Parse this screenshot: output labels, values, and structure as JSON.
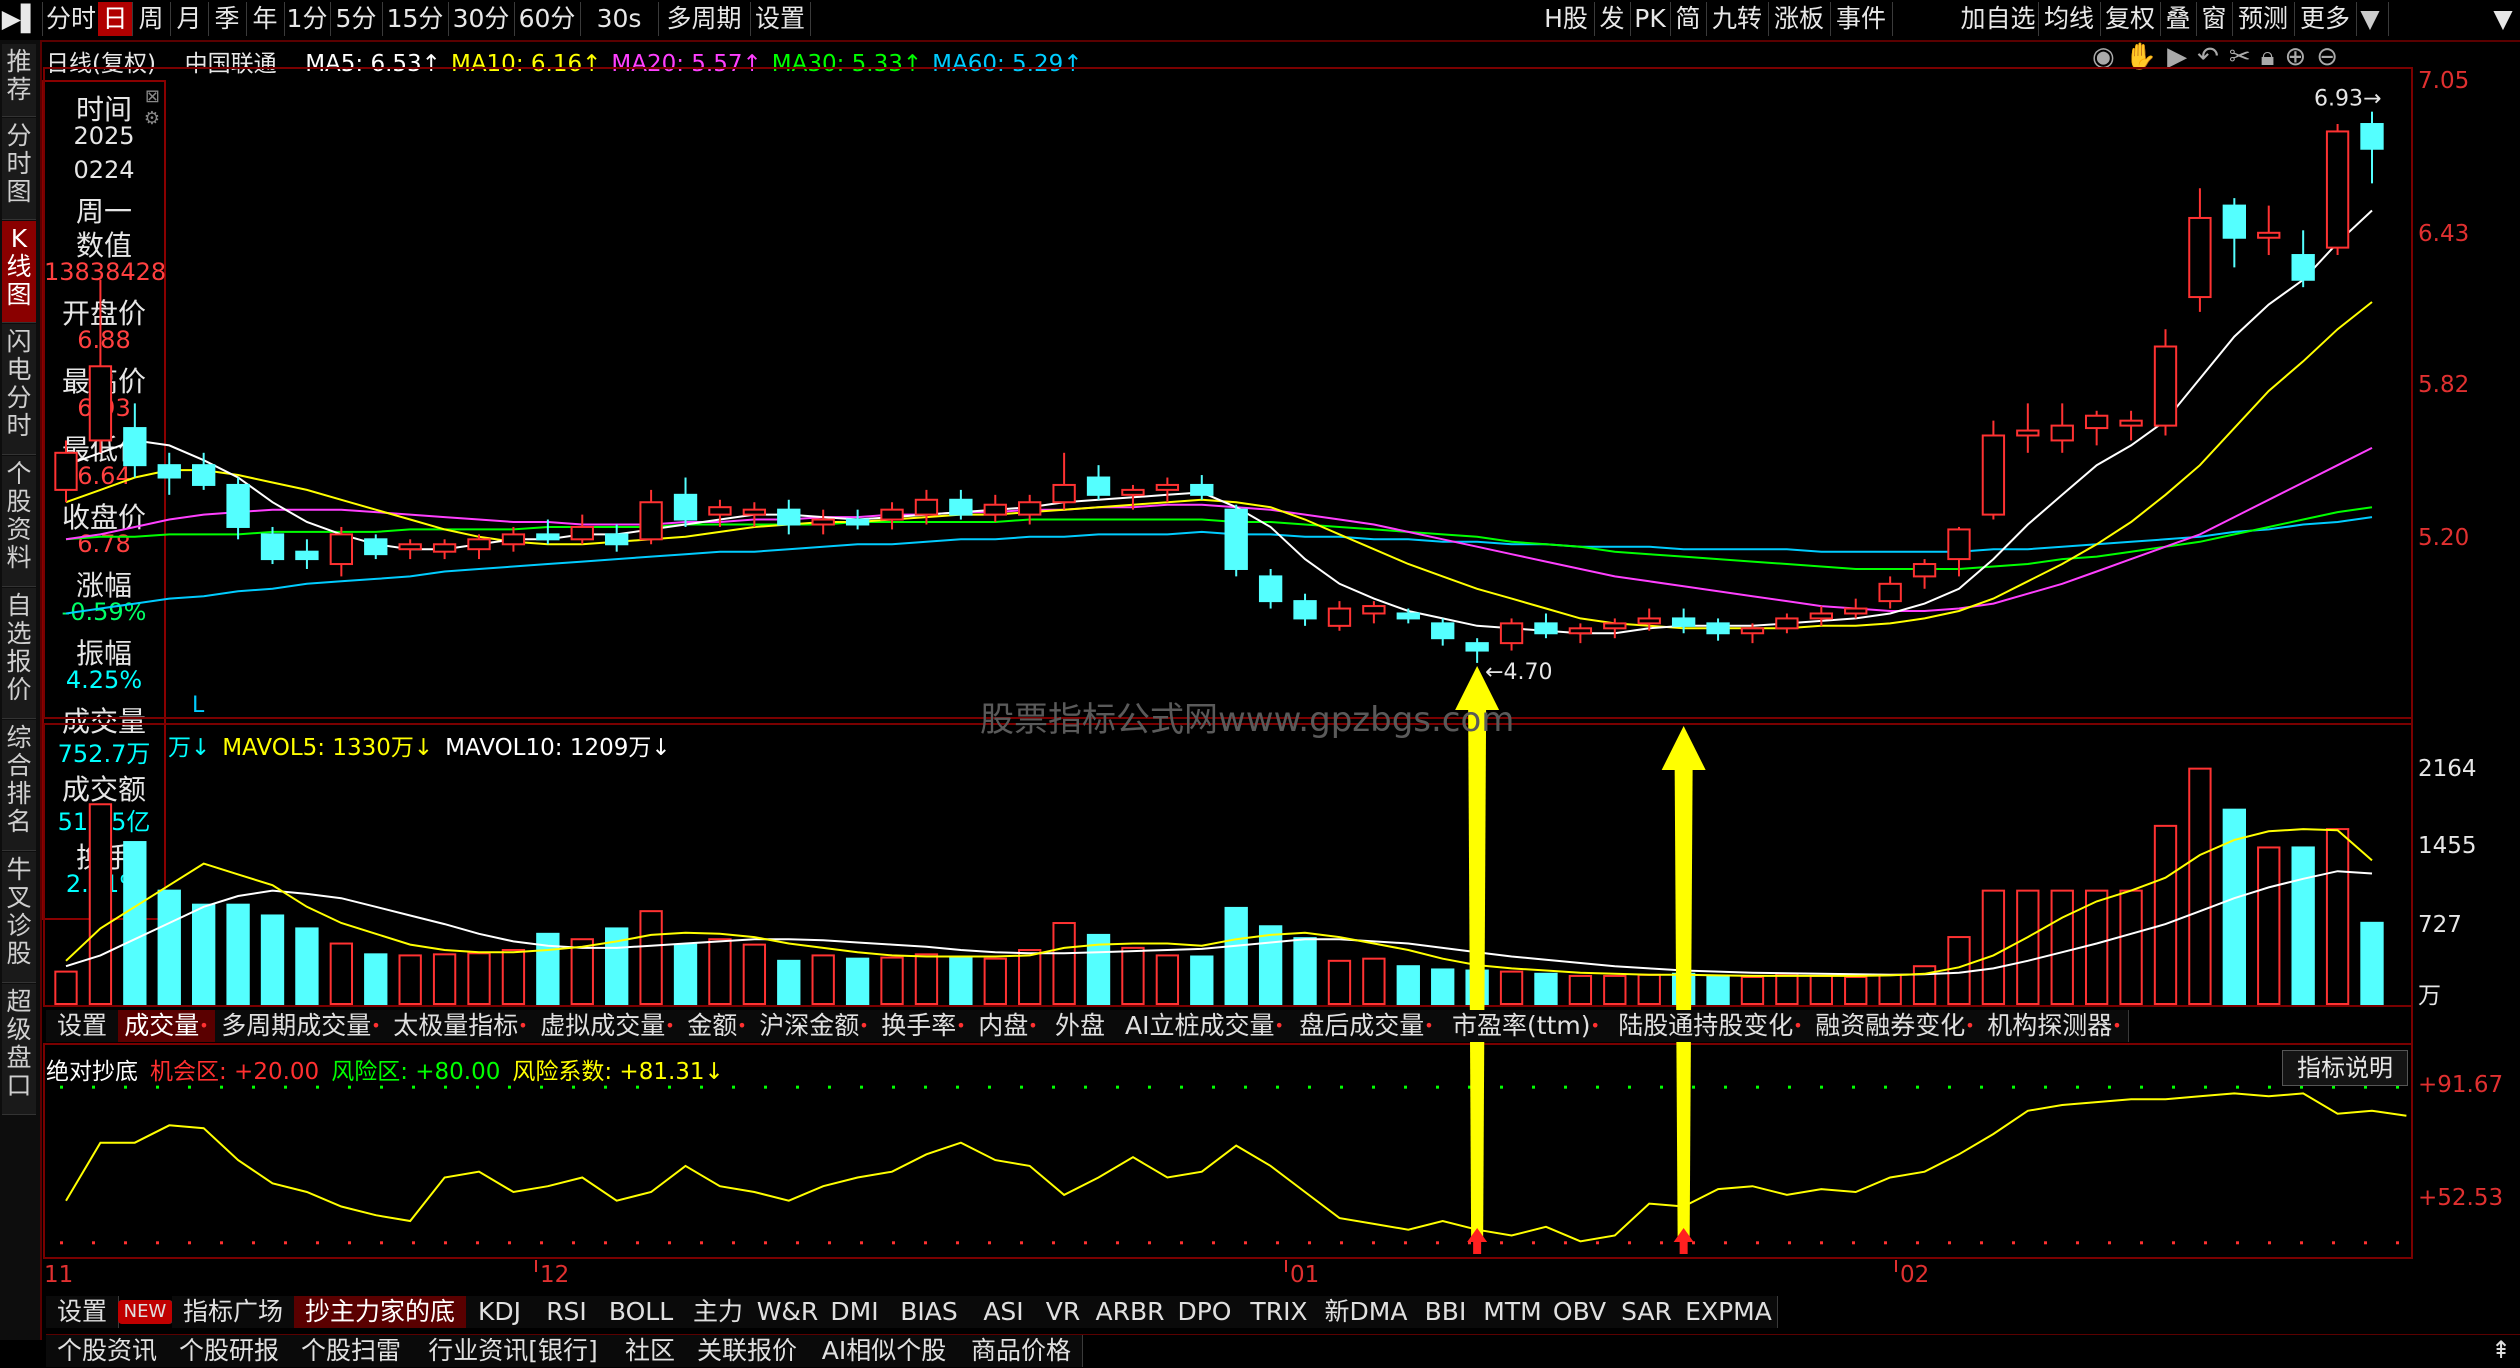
{
  "toolbar": {
    "left": [
      "分时",
      "日",
      "周",
      "月",
      "季",
      "年",
      "1分",
      "5分",
      "15分",
      "30分",
      "60分",
      "30s",
      "多周期",
      "设置"
    ],
    "right": [
      "H股",
      "发",
      "PK",
      "简",
      "九转",
      "涨板",
      "事件",
      "加自选",
      "均线",
      "复权",
      "叠",
      "窗",
      "预测",
      "更多"
    ]
  },
  "sidebar": [
    "推荐",
    "分时图",
    "K线图",
    "闪电分时",
    "个股资料",
    "自选报价",
    "综合排名",
    "牛叉诊股",
    "超级盘口"
  ],
  "header": {
    "period": "日线(复权)",
    "stock": "中国联通",
    "ma": [
      {
        "label": "MA5: 6.53↑",
        "color": "#ffffff"
      },
      {
        "label": "MA10: 6.16↑",
        "color": "#ffff00"
      },
      {
        "label": "MA20: 5.57↑",
        "color": "#ff40ff"
      },
      {
        "label": "MA30: 5.33↑",
        "color": "#00ff00"
      },
      {
        "label": "MA60: 5.29↑",
        "color": "#00ccff"
      }
    ]
  },
  "infopanel": {
    "items": [
      {
        "label": "时间",
        "value": "2025"
      },
      {
        "label": "",
        "value": "0224"
      },
      {
        "label": "周一",
        "value": ""
      },
      {
        "label": "数值",
        "value": "13838428"
      },
      {
        "label": "开盘价",
        "value": "6.88"
      },
      {
        "label": "最高价",
        "value": "6.93"
      },
      {
        "label": "最低价",
        "value": "6.64"
      },
      {
        "label": "收盘价",
        "value": "6.78"
      },
      {
        "label": "涨幅",
        "value": "-0.59%"
      },
      {
        "label": "振幅",
        "value": "4.25%"
      },
      {
        "label": "成交量",
        "value": "752.7万"
      },
      {
        "label": "成交额",
        "value": "51.35亿"
      },
      {
        "label": "换手",
        "value": "2.41%"
      }
    ]
  },
  "price_axis": [
    "7.05",
    "6.43",
    "5.82",
    "5.20"
  ],
  "price_annotations": {
    "high": "6.93",
    "low": "4.70",
    "marker": "L"
  },
  "watermark": "股票指标公式网www.gpzbgs.com",
  "volume": {
    "legend": [
      {
        "label": "万↓",
        "color": "#00ffff"
      },
      {
        "label": "MAVOL5: 1330万↓",
        "color": "#ffff00"
      },
      {
        "label": "MAVOL10: 1209万↓",
        "color": "#ffffff"
      }
    ],
    "axis": [
      "2164",
      "1455",
      "727",
      "万"
    ]
  },
  "volume_tabs": [
    "设置",
    "成交量",
    "多周期成交量",
    "太极量指标",
    "虚拟成交量",
    "金额",
    "沪深金额",
    "换手率",
    "内盘",
    "外盘",
    "AI立桩成交量",
    "盘后成交量",
    "市盈率(ttm)",
    "陆股通持股变化",
    "融资融券变化",
    "机构探测器"
  ],
  "indicator": {
    "legend": [
      {
        "label": "绝对抄底",
        "color": "#ffffff"
      },
      {
        "label": "机会区: +20.00",
        "color": "#ff3030"
      },
      {
        "label": "风险区: +80.00",
        "color": "#00ff00"
      },
      {
        "label": "风险系数: +81.31↓",
        "color": "#ffff00"
      }
    ],
    "explain_button": "指标说明",
    "axis": [
      "+91.67",
      "+52.53"
    ]
  },
  "date_axis": [
    "11",
    "12",
    "01",
    "02"
  ],
  "indicator_tabs": [
    "设置",
    "NEW",
    "指标广场",
    "抄主力家的底",
    "KDJ",
    "RSI",
    "BOLL",
    "主力",
    "W&R",
    "DMI",
    "BIAS",
    "ASI",
    "VR",
    "ARBR",
    "DPO",
    "TRIX",
    "新DMA",
    "BBI",
    "MTM",
    "OBV",
    "SAR",
    "EXPMA"
  ],
  "bottom_tabs": [
    "个股资讯",
    "个股研报",
    "个股扫雷",
    "行业资讯[银行]",
    "社区",
    "关联报价",
    "AI相似个股",
    "商品价格"
  ],
  "chart_data": {
    "type": "candlestick",
    "price_range": [
      4.55,
      7.05
    ],
    "candles": [
      {
        "o": 5.4,
        "h": 5.6,
        "l": 5.35,
        "c": 5.55
      },
      {
        "o": 5.6,
        "h": 6.25,
        "l": 5.55,
        "c": 5.9
      },
      {
        "o": 5.65,
        "h": 5.75,
        "l": 5.45,
        "c": 5.5
      },
      {
        "o": 5.5,
        "h": 5.55,
        "l": 5.38,
        "c": 5.45
      },
      {
        "o": 5.5,
        "h": 5.55,
        "l": 5.4,
        "c": 5.42
      },
      {
        "o": 5.42,
        "h": 5.45,
        "l": 5.2,
        "c": 5.25
      },
      {
        "o": 5.22,
        "h": 5.25,
        "l": 5.1,
        "c": 5.12
      },
      {
        "o": 5.15,
        "h": 5.2,
        "l": 5.08,
        "c": 5.12
      },
      {
        "o": 5.1,
        "h": 5.25,
        "l": 5.05,
        "c": 5.22
      },
      {
        "o": 5.2,
        "h": 5.22,
        "l": 5.12,
        "c": 5.14
      },
      {
        "o": 5.16,
        "h": 5.2,
        "l": 5.12,
        "c": 5.18
      },
      {
        "o": 5.15,
        "h": 5.2,
        "l": 5.12,
        "c": 5.18
      },
      {
        "o": 5.16,
        "h": 5.22,
        "l": 5.12,
        "c": 5.2
      },
      {
        "o": 5.18,
        "h": 5.25,
        "l": 5.15,
        "c": 5.22
      },
      {
        "o": 5.22,
        "h": 5.28,
        "l": 5.18,
        "c": 5.2
      },
      {
        "o": 5.2,
        "h": 5.3,
        "l": 5.18,
        "c": 5.25
      },
      {
        "o": 5.22,
        "h": 5.26,
        "l": 5.15,
        "c": 5.18
      },
      {
        "o": 5.2,
        "h": 5.4,
        "l": 5.18,
        "c": 5.35
      },
      {
        "o": 5.38,
        "h": 5.45,
        "l": 5.25,
        "c": 5.28
      },
      {
        "o": 5.3,
        "h": 5.36,
        "l": 5.25,
        "c": 5.33
      },
      {
        "o": 5.3,
        "h": 5.35,
        "l": 5.25,
        "c": 5.32
      },
      {
        "o": 5.32,
        "h": 5.36,
        "l": 5.22,
        "c": 5.26
      },
      {
        "o": 5.26,
        "h": 5.32,
        "l": 5.22,
        "c": 5.28
      },
      {
        "o": 5.28,
        "h": 5.32,
        "l": 5.24,
        "c": 5.26
      },
      {
        "o": 5.28,
        "h": 5.35,
        "l": 5.24,
        "c": 5.32
      },
      {
        "o": 5.3,
        "h": 5.4,
        "l": 5.26,
        "c": 5.36
      },
      {
        "o": 5.36,
        "h": 5.4,
        "l": 5.28,
        "c": 5.3
      },
      {
        "o": 5.3,
        "h": 5.38,
        "l": 5.27,
        "c": 5.34
      },
      {
        "o": 5.3,
        "h": 5.38,
        "l": 5.26,
        "c": 5.35
      },
      {
        "o": 5.35,
        "h": 5.55,
        "l": 5.32,
        "c": 5.42
      },
      {
        "o": 5.45,
        "h": 5.5,
        "l": 5.36,
        "c": 5.38
      },
      {
        "o": 5.38,
        "h": 5.42,
        "l": 5.32,
        "c": 5.4
      },
      {
        "o": 5.4,
        "h": 5.45,
        "l": 5.35,
        "c": 5.42
      },
      {
        "o": 5.42,
        "h": 5.46,
        "l": 5.36,
        "c": 5.38
      },
      {
        "o": 5.32,
        "h": 5.34,
        "l": 5.05,
        "c": 5.08
      },
      {
        "o": 5.05,
        "h": 5.08,
        "l": 4.92,
        "c": 4.95
      },
      {
        "o": 4.95,
        "h": 4.98,
        "l": 4.85,
        "c": 4.88
      },
      {
        "o": 4.85,
        "h": 4.95,
        "l": 4.83,
        "c": 4.92
      },
      {
        "o": 4.9,
        "h": 4.95,
        "l": 4.86,
        "c": 4.93
      },
      {
        "o": 4.9,
        "h": 4.92,
        "l": 4.86,
        "c": 4.88
      },
      {
        "o": 4.86,
        "h": 4.88,
        "l": 4.77,
        "c": 4.8
      },
      {
        "o": 4.78,
        "h": 4.8,
        "l": 4.7,
        "c": 4.75
      },
      {
        "o": 4.78,
        "h": 4.88,
        "l": 4.75,
        "c": 4.86
      },
      {
        "o": 4.86,
        "h": 4.9,
        "l": 4.8,
        "c": 4.82
      },
      {
        "o": 4.82,
        "h": 4.86,
        "l": 4.78,
        "c": 4.84
      },
      {
        "o": 4.84,
        "h": 4.88,
        "l": 4.8,
        "c": 4.86
      },
      {
        "o": 4.86,
        "h": 4.92,
        "l": 4.83,
        "c": 4.88
      },
      {
        "o": 4.88,
        "h": 4.92,
        "l": 4.82,
        "c": 4.85
      },
      {
        "o": 4.86,
        "h": 4.88,
        "l": 4.79,
        "c": 4.82
      },
      {
        "o": 4.82,
        "h": 4.86,
        "l": 4.78,
        "c": 4.84
      },
      {
        "o": 4.84,
        "h": 4.9,
        "l": 4.82,
        "c": 4.88
      },
      {
        "o": 4.88,
        "h": 4.93,
        "l": 4.85,
        "c": 4.9
      },
      {
        "o": 4.9,
        "h": 4.96,
        "l": 4.88,
        "c": 4.92
      },
      {
        "o": 4.95,
        "h": 5.05,
        "l": 4.92,
        "c": 5.02
      },
      {
        "o": 5.05,
        "h": 5.12,
        "l": 5.0,
        "c": 5.1
      },
      {
        "o": 5.12,
        "h": 5.25,
        "l": 5.05,
        "c": 5.24
      },
      {
        "o": 5.3,
        "h": 5.68,
        "l": 5.28,
        "c": 5.62
      },
      {
        "o": 5.62,
        "h": 5.75,
        "l": 5.55,
        "c": 5.64
      },
      {
        "o": 5.6,
        "h": 5.75,
        "l": 5.55,
        "c": 5.66
      },
      {
        "o": 5.65,
        "h": 5.72,
        "l": 5.58,
        "c": 5.7
      },
      {
        "o": 5.66,
        "h": 5.72,
        "l": 5.6,
        "c": 5.68
      },
      {
        "o": 5.66,
        "h": 6.05,
        "l": 5.62,
        "c": 5.98
      },
      {
        "o": 6.18,
        "h": 6.62,
        "l": 6.12,
        "c": 6.5
      },
      {
        "o": 6.55,
        "h": 6.58,
        "l": 6.3,
        "c": 6.42
      },
      {
        "o": 6.42,
        "h": 6.55,
        "l": 6.35,
        "c": 6.44
      },
      {
        "o": 6.35,
        "h": 6.45,
        "l": 6.22,
        "c": 6.25
      },
      {
        "o": 6.38,
        "h": 6.88,
        "l": 6.35,
        "c": 6.85
      },
      {
        "o": 6.88,
        "h": 6.93,
        "l": 6.64,
        "c": 6.78
      }
    ],
    "ma5": [
      5.5,
      5.55,
      5.6,
      5.58,
      5.52,
      5.45,
      5.35,
      5.27,
      5.22,
      5.18,
      5.16,
      5.16,
      5.18,
      5.2,
      5.2,
      5.22,
      5.22,
      5.24,
      5.26,
      5.28,
      5.3,
      5.3,
      5.29,
      5.28,
      5.29,
      5.3,
      5.31,
      5.32,
      5.33,
      5.35,
      5.36,
      5.37,
      5.38,
      5.39,
      5.33,
      5.25,
      5.12,
      5.02,
      4.96,
      4.91,
      4.88,
      4.85,
      4.84,
      4.83,
      4.82,
      4.82,
      4.84,
      4.85,
      4.85,
      4.85,
      4.86,
      4.87,
      4.88,
      4.9,
      4.94,
      5.0,
      5.12,
      5.26,
      5.38,
      5.5,
      5.58,
      5.68,
      5.85,
      6.02,
      6.15,
      6.25,
      6.4,
      6.53
    ],
    "ma10": [
      5.35,
      5.4,
      5.45,
      5.48,
      5.48,
      5.46,
      5.43,
      5.4,
      5.36,
      5.32,
      5.28,
      5.24,
      5.21,
      5.19,
      5.18,
      5.18,
      5.19,
      5.2,
      5.21,
      5.23,
      5.25,
      5.26,
      5.27,
      5.27,
      5.28,
      5.29,
      5.3,
      5.3,
      5.31,
      5.32,
      5.33,
      5.34,
      5.35,
      5.36,
      5.35,
      5.33,
      5.28,
      5.22,
      5.16,
      5.1,
      5.05,
      5.0,
      4.96,
      4.92,
      4.88,
      4.86,
      4.85,
      4.84,
      4.84,
      4.84,
      4.84,
      4.85,
      4.85,
      4.86,
      4.88,
      4.91,
      4.96,
      5.03,
      5.1,
      5.18,
      5.27,
      5.38,
      5.5,
      5.65,
      5.8,
      5.92,
      6.05,
      6.16
    ],
    "ma20": [
      5.2,
      5.22,
      5.25,
      5.28,
      5.3,
      5.31,
      5.32,
      5.32,
      5.32,
      5.31,
      5.3,
      5.29,
      5.28,
      5.27,
      5.27,
      5.26,
      5.26,
      5.26,
      5.27,
      5.27,
      5.28,
      5.28,
      5.29,
      5.29,
      5.3,
      5.3,
      5.31,
      5.31,
      5.32,
      5.32,
      5.33,
      5.33,
      5.34,
      5.34,
      5.33,
      5.32,
      5.3,
      5.28,
      5.26,
      5.23,
      5.2,
      5.17,
      5.14,
      5.11,
      5.08,
      5.05,
      5.03,
      5.01,
      4.99,
      4.97,
      4.95,
      4.93,
      4.92,
      4.91,
      4.91,
      4.92,
      4.94,
      4.98,
      5.02,
      5.07,
      5.12,
      5.17,
      5.22,
      5.29,
      5.36,
      5.43,
      5.5,
      5.57
    ],
    "ma30": [
      5.2,
      5.21,
      5.21,
      5.22,
      5.22,
      5.22,
      5.23,
      5.23,
      5.23,
      5.23,
      5.24,
      5.24,
      5.24,
      5.24,
      5.25,
      5.25,
      5.25,
      5.25,
      5.26,
      5.26,
      5.26,
      5.26,
      5.26,
      5.27,
      5.27,
      5.27,
      5.27,
      5.27,
      5.28,
      5.28,
      5.28,
      5.28,
      5.28,
      5.28,
      5.27,
      5.27,
      5.26,
      5.25,
      5.24,
      5.23,
      5.22,
      5.21,
      5.19,
      5.18,
      5.17,
      5.15,
      5.14,
      5.13,
      5.12,
      5.11,
      5.1,
      5.09,
      5.08,
      5.08,
      5.08,
      5.08,
      5.09,
      5.1,
      5.12,
      5.13,
      5.15,
      5.17,
      5.19,
      5.22,
      5.25,
      5.28,
      5.31,
      5.33
    ],
    "ma60": [
      4.9,
      4.92,
      4.94,
      4.96,
      4.97,
      4.99,
      5.0,
      5.02,
      5.03,
      5.04,
      5.05,
      5.07,
      5.08,
      5.09,
      5.1,
      5.11,
      5.12,
      5.13,
      5.14,
      5.15,
      5.15,
      5.16,
      5.17,
      5.18,
      5.18,
      5.19,
      5.2,
      5.2,
      5.21,
      5.21,
      5.22,
      5.22,
      5.22,
      5.23,
      5.22,
      5.22,
      5.21,
      5.21,
      5.2,
      5.2,
      5.19,
      5.19,
      5.18,
      5.18,
      5.17,
      5.17,
      5.17,
      5.16,
      5.16,
      5.16,
      5.16,
      5.15,
      5.15,
      5.15,
      5.15,
      5.15,
      5.16,
      5.16,
      5.17,
      5.18,
      5.19,
      5.2,
      5.21,
      5.23,
      5.24,
      5.26,
      5.27,
      5.29
    ],
    "volume": [
      300,
      1850,
      1500,
      1050,
      920,
      920,
      820,
      700,
      560,
      460,
      450,
      460,
      470,
      500,
      650,
      600,
      700,
      860,
      550,
      600,
      550,
      400,
      450,
      420,
      430,
      460,
      430,
      420,
      500,
      750,
      640,
      520,
      450,
      440,
      890,
      720,
      610,
      400,
      420,
      350,
      320,
      310,
      300,
      280,
      260,
      260,
      270,
      280,
      250,
      250,
      280,
      260,
      250,
      270,
      350,
      620,
      1050,
      1050,
      1050,
      1050,
      1050,
      1650,
      2180,
      1800,
      1450,
      1450,
      1620,
      752
    ],
    "mavol5": [
      400,
      700,
      900,
      1100,
      1300,
      1200,
      1100,
      900,
      750,
      650,
      550,
      500,
      480,
      480,
      500,
      530,
      580,
      640,
      660,
      650,
      620,
      560,
      520,
      480,
      450,
      440,
      440,
      440,
      450,
      520,
      550,
      560,
      560,
      540,
      600,
      640,
      660,
      620,
      560,
      500,
      420,
      360,
      330,
      310,
      290,
      280,
      270,
      270,
      265,
      260,
      260,
      260,
      260,
      265,
      280,
      340,
      450,
      620,
      800,
      950,
      1050,
      1170,
      1380,
      1520,
      1600,
      1620,
      1610,
      1330
    ],
    "mavol10": [
      350,
      450,
      600,
      750,
      900,
      1000,
      1050,
      1020,
      980,
      900,
      820,
      740,
      650,
      580,
      540,
      520,
      520,
      540,
      560,
      580,
      600,
      600,
      590,
      570,
      550,
      530,
      500,
      480,
      470,
      470,
      480,
      490,
      500,
      510,
      540,
      570,
      600,
      600,
      580,
      560,
      520,
      480,
      440,
      410,
      380,
      350,
      330,
      310,
      300,
      290,
      285,
      280,
      275,
      270,
      275,
      290,
      330,
      400,
      480,
      560,
      650,
      740,
      860,
      980,
      1080,
      1160,
      1230,
      1209
    ],
    "indicator": [
      52,
      72,
      72,
      78,
      77,
      66,
      58,
      55,
      50,
      47,
      45,
      60,
      62,
      55,
      57,
      60,
      52,
      55,
      64,
      57,
      55,
      52,
      57,
      60,
      62,
      68,
      72,
      66,
      64,
      54,
      60,
      67,
      60,
      62,
      71,
      64,
      55,
      46,
      44,
      42,
      45,
      42,
      40,
      43,
      38,
      40,
      51,
      50,
      56,
      57,
      54,
      56,
      55,
      60,
      62,
      68,
      75,
      83,
      85,
      86,
      87,
      87,
      88,
      89,
      88,
      89,
      82,
      83,
      81.31
    ],
    "indicator_range": [
      35,
      95
    ],
    "signal_arrows": [
      41,
      47
    ]
  }
}
